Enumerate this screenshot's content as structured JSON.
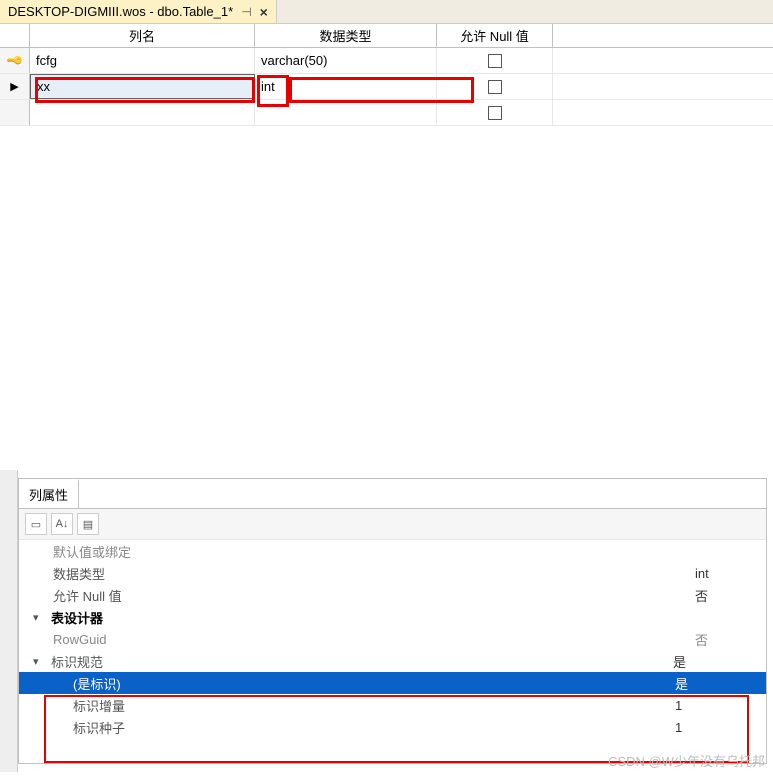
{
  "tab": {
    "title": "DESKTOP-DIGMIII.wos - dbo.Table_1*"
  },
  "columns_header": {
    "name": "列名",
    "type": "数据类型",
    "allow_null": "允许 Null 值"
  },
  "rows": [
    {
      "name": "fcfg",
      "type": "varchar(50)",
      "is_key": true
    },
    {
      "name": "xx",
      "type": "int",
      "is_selected": true
    }
  ],
  "properties": {
    "tab_label": "列属性",
    "items": {
      "default_binding": {
        "label": "默认值或绑定",
        "value": ""
      },
      "data_type": {
        "label": "数据类型",
        "value": "int"
      },
      "allow_null": {
        "label": "允许 Null 值",
        "value": "否"
      },
      "table_designer": {
        "label": "表设计器"
      },
      "row_guid": {
        "label": "RowGuid",
        "value": "否"
      },
      "identity_spec": {
        "label": "标识规范",
        "value": "是"
      },
      "is_identity": {
        "label": "(是标识)",
        "value": "是"
      },
      "identity_increment": {
        "label": "标识增量",
        "value": "1"
      },
      "identity_seed": {
        "label": "标识种子",
        "value": "1"
      }
    }
  },
  "watermark": "CSDN @W少年没有乌托邦"
}
